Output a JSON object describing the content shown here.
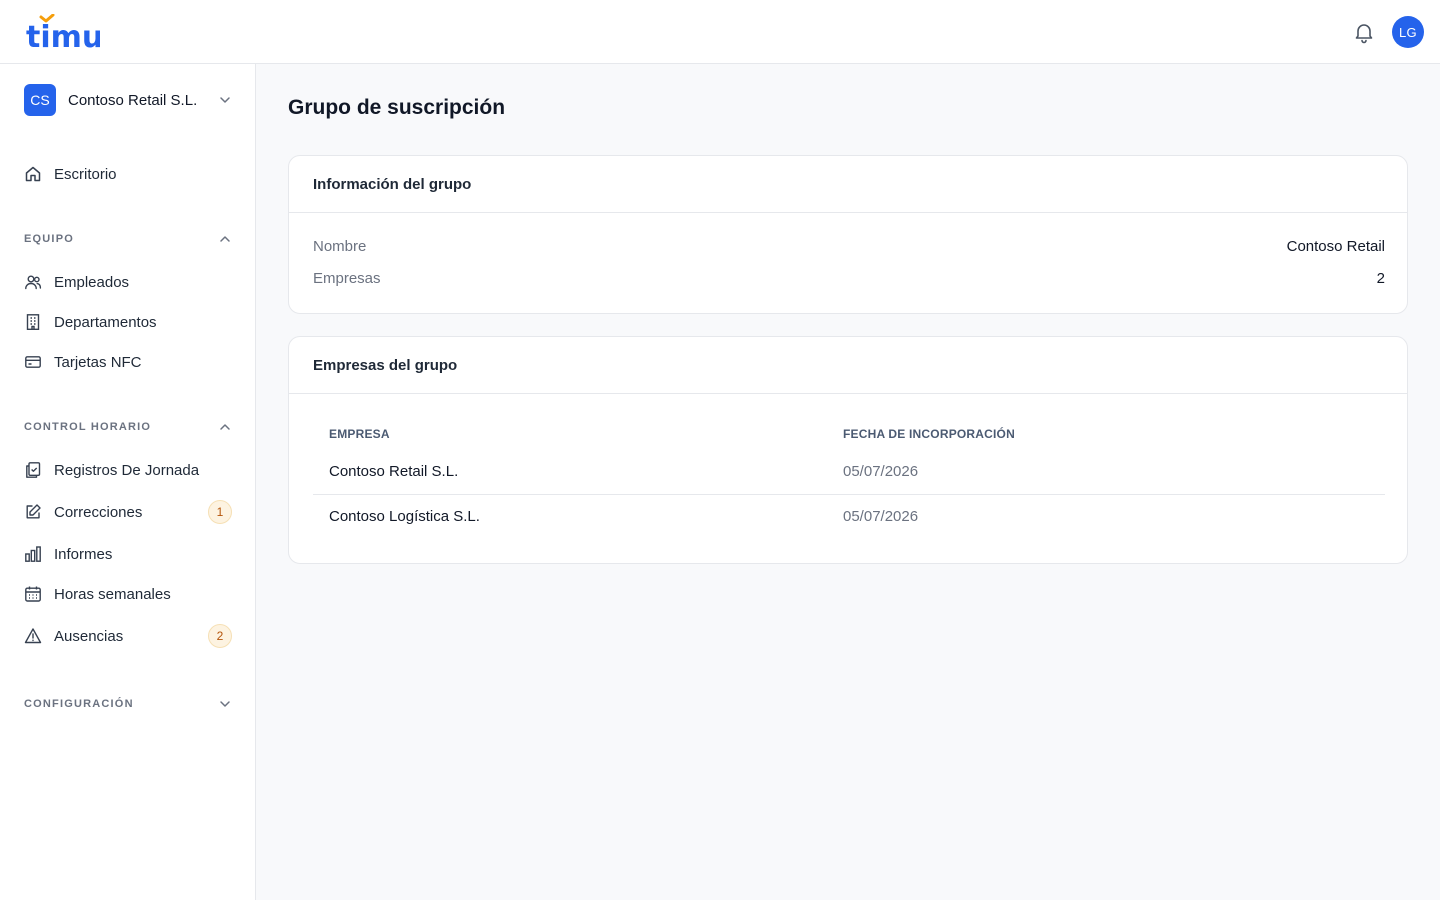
{
  "app": {
    "logo_text": "timu"
  },
  "header": {
    "user_initials": "LG",
    "notifications_icon": "bell-icon"
  },
  "sidebar": {
    "company": {
      "initials": "CS",
      "name": "Contoso Retail S.L."
    },
    "dashboard": {
      "label": "Escritorio",
      "icon": "home-icon"
    },
    "sections": {
      "equipo": {
        "title": "EQUIPO",
        "expanded": true
      },
      "control": {
        "title": "CONTROL HORARIO",
        "expanded": true
      },
      "config": {
        "title": "CONFIGURACIÓN",
        "expanded": false
      }
    },
    "items": {
      "empleados": {
        "label": "Empleados",
        "icon": "users-icon"
      },
      "departamentos": {
        "label": "Departamentos",
        "icon": "building-icon"
      },
      "tarjetas": {
        "label": "Tarjetas NFC",
        "icon": "card-icon"
      },
      "registros": {
        "label": "Registros De Jornada",
        "icon": "clipboard-check-icon"
      },
      "correcciones": {
        "label": "Correcciones",
        "icon": "edit-icon",
        "badge": "1"
      },
      "informes": {
        "label": "Informes",
        "icon": "bar-chart-icon"
      },
      "horas": {
        "label": "Horas semanales",
        "icon": "calendar-icon"
      },
      "ausencias": {
        "label": "Ausencias",
        "icon": "warning-icon",
        "badge": "2"
      }
    }
  },
  "main": {
    "title": "Grupo de suscripción",
    "info_card": {
      "title": "Información del grupo",
      "rows": [
        {
          "key": "Nombre",
          "value": "Contoso Retail"
        },
        {
          "key": "Empresas",
          "value": "2"
        }
      ]
    },
    "companies_card": {
      "title": "Empresas del grupo",
      "columns": [
        "EMPRESA",
        "FECHA DE INCORPORACIÓN"
      ],
      "rows": [
        {
          "name": "Contoso Retail S.L.",
          "date": "05/07/2026"
        },
        {
          "name": "Contoso Logística S.L.",
          "date": "05/07/2026"
        }
      ]
    }
  },
  "colors": {
    "accent": "#2563eb",
    "logo_accent": "#f59e0b",
    "badge_bg": "#fdf3e1",
    "badge_text": "#b45309"
  }
}
